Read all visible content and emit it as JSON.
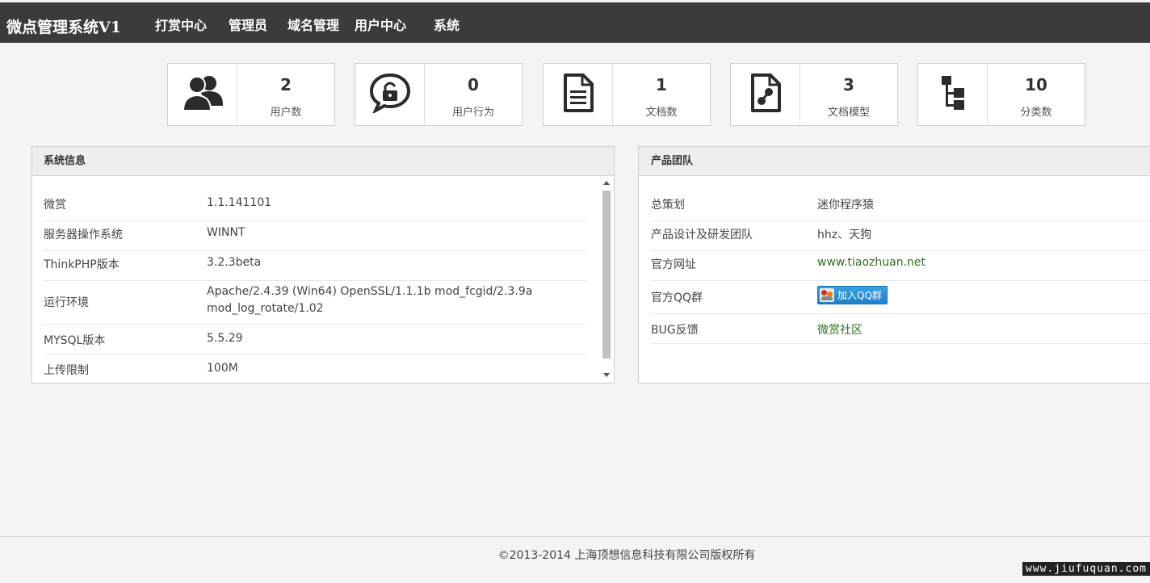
{
  "app": {
    "title": "微点管理系统V1"
  },
  "nav": [
    {
      "label": "打赏中心"
    },
    {
      "label": "管理员"
    },
    {
      "label": "域名管理"
    },
    {
      "label": "用户中心"
    },
    {
      "label": "系统"
    }
  ],
  "stats": [
    {
      "value": "2",
      "label": "用户数",
      "icon": "users-icon"
    },
    {
      "value": "0",
      "label": "用户行为",
      "icon": "lock-chat-icon"
    },
    {
      "value": "1",
      "label": "文档数",
      "icon": "document-icon"
    },
    {
      "value": "3",
      "label": "文档模型",
      "icon": "document-model-icon"
    },
    {
      "value": "10",
      "label": "分类数",
      "icon": "tree-icon"
    }
  ],
  "system_info": {
    "title": "系统信息",
    "rows": [
      {
        "key": "微赏",
        "value": "1.1.141101"
      },
      {
        "key": "服务器操作系统",
        "value": "WINNT"
      },
      {
        "key": "ThinkPHP版本",
        "value": "3.2.3beta"
      },
      {
        "key": "运行环境",
        "value": "Apache/2.4.39 (Win64) OpenSSL/1.1.1b mod_fcgid/2.3.9a",
        "value2": "mod_log_rotate/1.02"
      },
      {
        "key": "MYSQL版本",
        "value": "5.5.29"
      },
      {
        "key": "上传限制",
        "value": "100M"
      }
    ]
  },
  "team": {
    "title": "产品团队",
    "rows": [
      {
        "key": "总策划",
        "value": "迷你程序猿"
      },
      {
        "key": "产品设计及研发团队",
        "value": "hhz、天狗"
      },
      {
        "key": "官方网址",
        "value": "www.tiaozhuan.net"
      },
      {
        "key": "官方QQ群",
        "button": "加入QQ群"
      },
      {
        "key": "BUG反馈",
        "value": "微赏社区"
      }
    ]
  },
  "footer": {
    "copyright": "©2013-2014 上海顶想信息科技有限公司版权所有"
  },
  "watermark": "www.jiufuquan.com",
  "colors": {
    "topbar": "#3b3b3b",
    "link": "#2f6f1f",
    "qq_button": "#1d80c8"
  }
}
